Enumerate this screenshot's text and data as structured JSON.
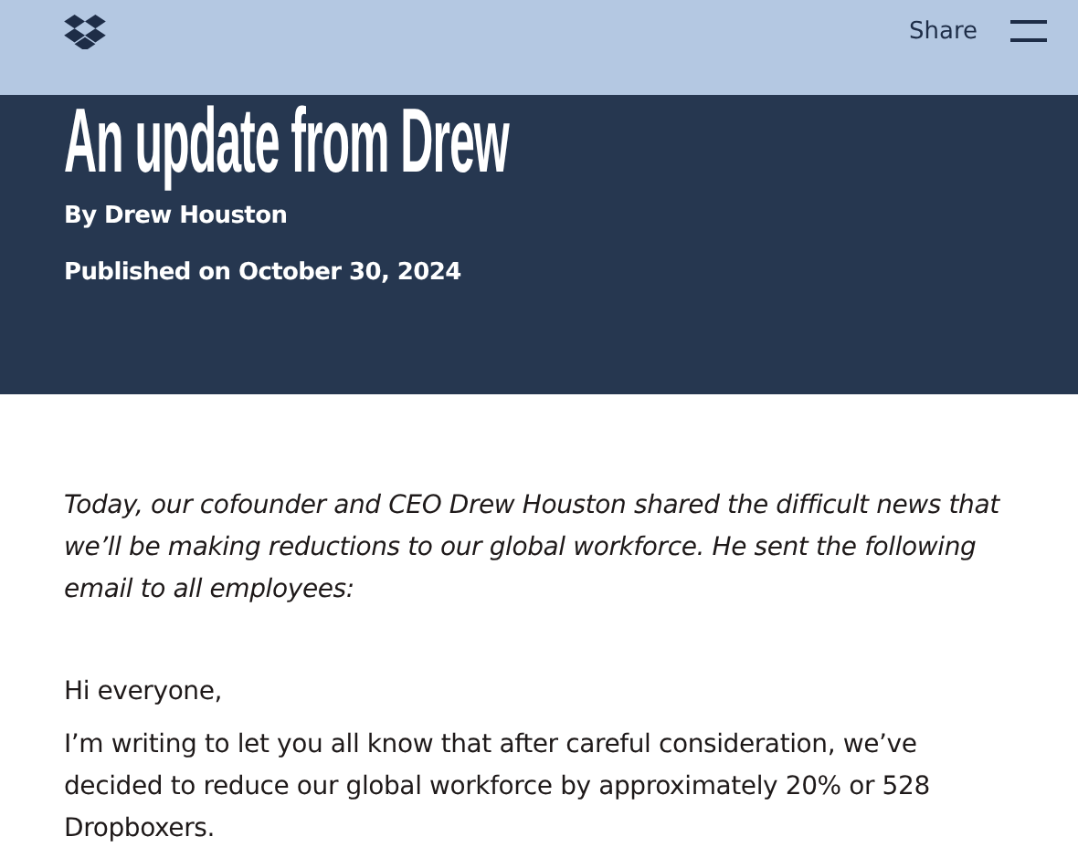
{
  "header": {
    "share": "Share"
  },
  "hero": {
    "title": "An update from Drew",
    "byline": "By Drew Houston",
    "published": "Published on October 30, 2024"
  },
  "intro": "Today, our cofounder and CEO Drew Houston shared the difficult news that we’ll be making reductions to our global workforce. He sent the following email to all employees:",
  "paragraphs": [
    "Hi everyone,",
    "I’m writing to let you all know that after careful consideration, we’ve decided to reduce our global workforce by approximately 20% or 528 Dropboxers."
  ]
}
